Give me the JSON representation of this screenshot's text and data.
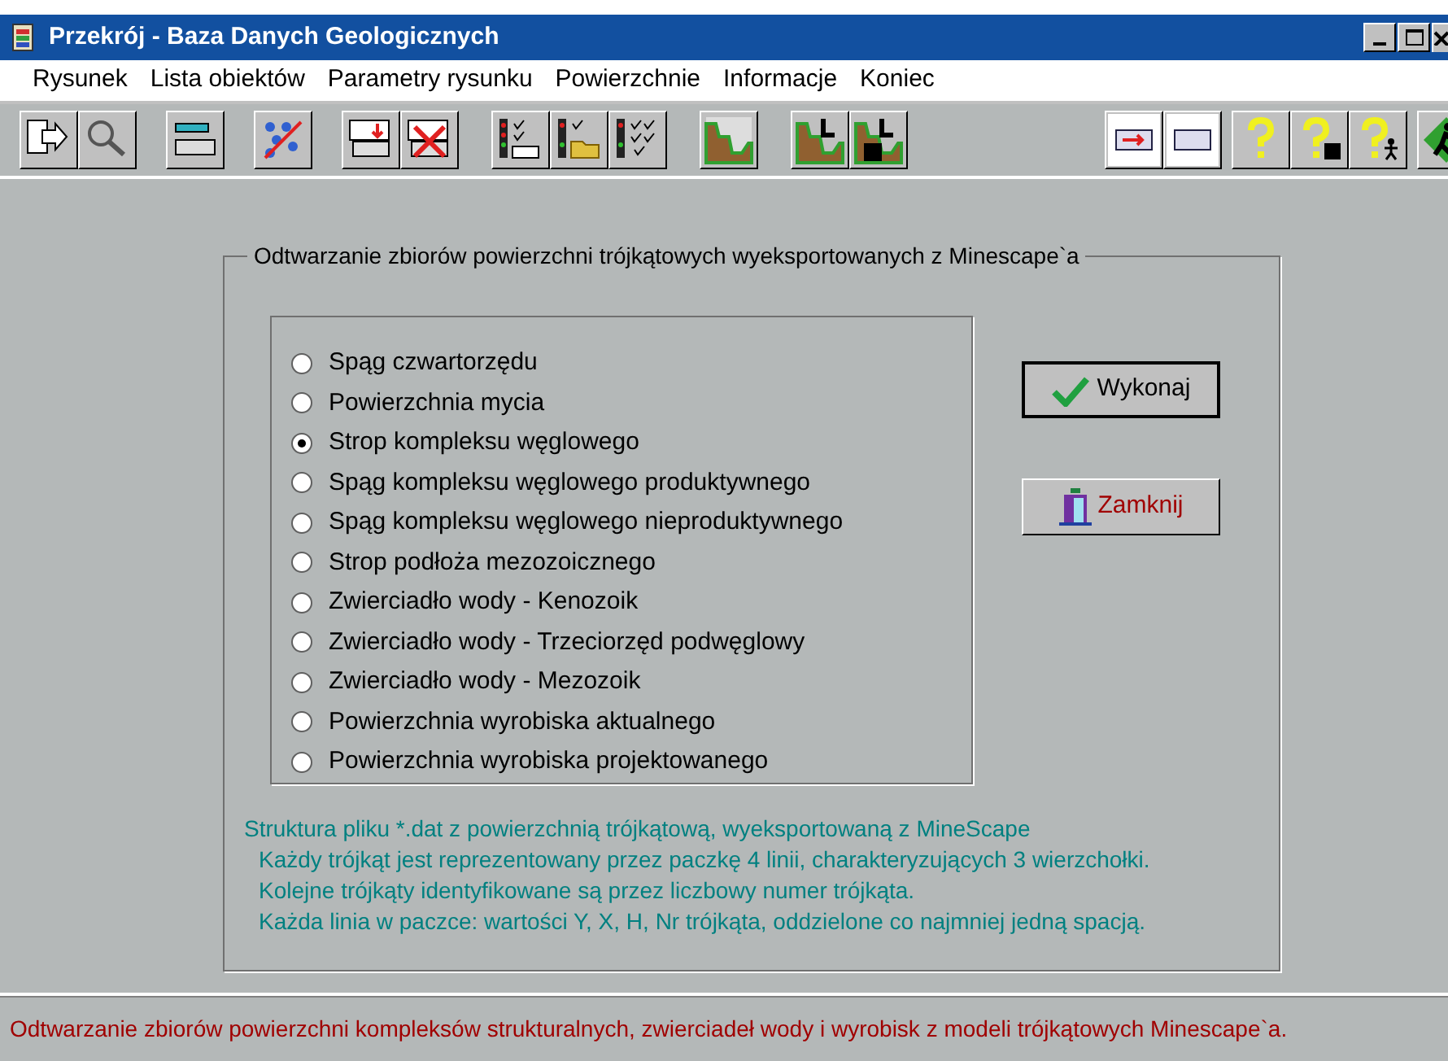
{
  "window": {
    "title": "Przekrój - Baza Danych Geologicznych"
  },
  "menu": [
    "Rysunek",
    "Lista obiektów",
    "Parametry rysunku",
    "Powierzchnie",
    "Informacje",
    "Koniec"
  ],
  "group": {
    "title": "Odtwarzanie zbiorów powierzchni trójkątowych wyeksportowanych z Minescape`a",
    "options": [
      {
        "label": "Spąg czwartorzędu",
        "selected": false
      },
      {
        "label": "Powierzchnia mycia",
        "selected": false
      },
      {
        "label": "Strop kompleksu węglowego",
        "selected": true
      },
      {
        "label": "Spąg kompleksu węglowego produktywnego",
        "selected": false
      },
      {
        "label": "Spąg kompleksu węglowego nieproduktywnego",
        "selected": false
      },
      {
        "label": "Strop podłoża mezozoicznego",
        "selected": false
      },
      {
        "label": "Zwierciadło wody - Kenozoik",
        "selected": false
      },
      {
        "label": "Zwierciadło wody - Trzeciorzęd podwęglowy",
        "selected": false
      },
      {
        "label": "Zwierciadło wody - Mezozoik",
        "selected": false
      },
      {
        "label": "Powierzchnia wyrobiska aktualnego",
        "selected": false
      },
      {
        "label": "Powierzchnia wyrobiska projektowanego",
        "selected": false
      }
    ],
    "buttons": [
      {
        "label": "Wykonaj",
        "kind": "ok"
      },
      {
        "label": "Zamknij",
        "kind": "close"
      }
    ],
    "info": [
      "Struktura pliku *.dat z powierzchnią trójkątową, wyeksportowaną z MineScape",
      "Każdy trójkąt jest reprezentowany przez paczkę 4 linii, charakteryzujących 3 wierzchołki.",
      "Kolejne trójkąty identyfikowane są przez liczbowy numer trójkąta.",
      "Każda linia w paczce: wartości Y, X, H, Nr trójkąta, oddzielone co najmniej jedną spacją."
    ]
  },
  "status_bar": "Odtwarzanie zbiorów powierzchni kompleksów strukturalnych, zwierciadeł wody i wyrobisk z modeli trójkątowych Minescape`a."
}
